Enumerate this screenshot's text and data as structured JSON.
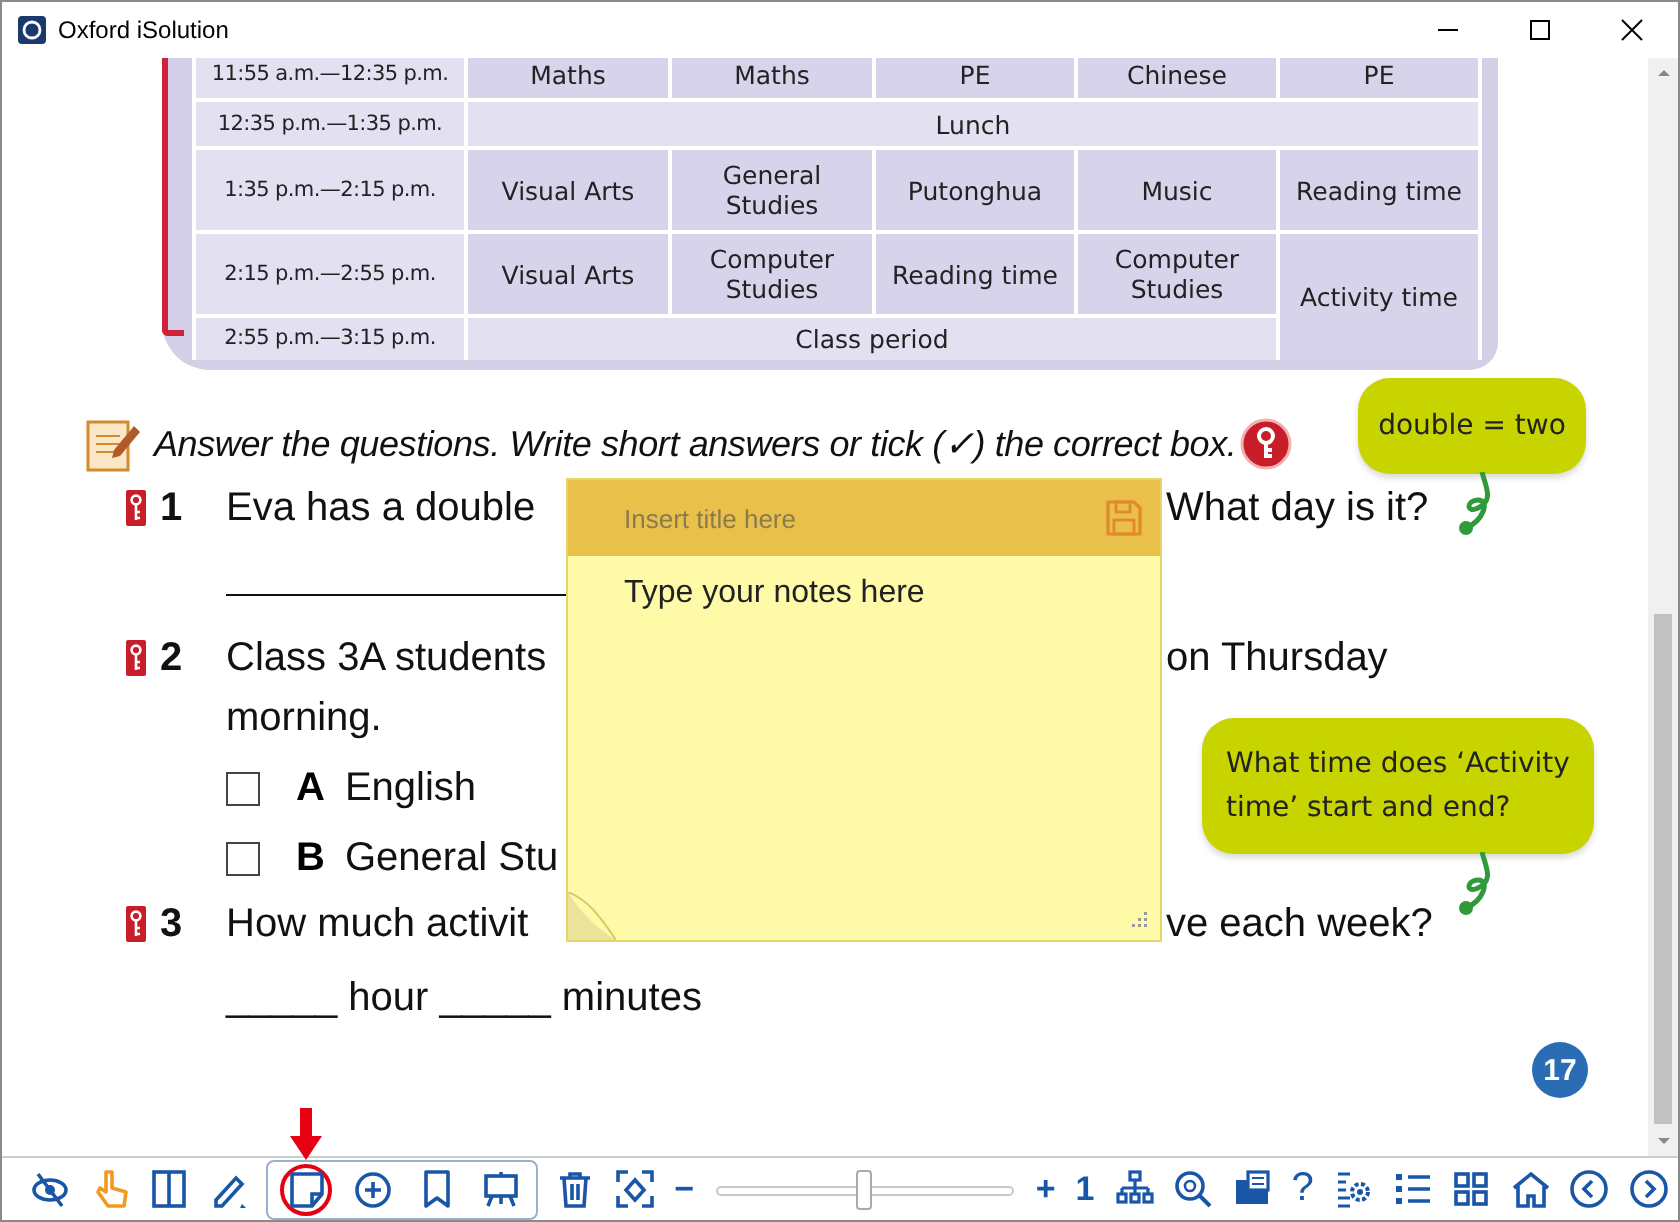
{
  "window": {
    "title": "Oxford iSolution"
  },
  "timetable": {
    "rows": [
      {
        "time": "11:55 a.m.—12:35 p.m.",
        "cells": [
          {
            "text": "Maths"
          },
          {
            "text": "Maths"
          },
          {
            "text": "PE"
          },
          {
            "text": "Chinese"
          },
          {
            "text": "PE"
          }
        ]
      },
      {
        "time": "12:35 p.m.—1:35 p.m.",
        "kind": "break",
        "cells": [
          {
            "text": "Lunch",
            "colspan": 5
          }
        ]
      },
      {
        "time": "1:35 p.m.—2:15 p.m.",
        "cells": [
          {
            "text": "Visual Arts"
          },
          {
            "text": "General Studies"
          },
          {
            "text": "Putonghua"
          },
          {
            "text": "Music"
          },
          {
            "text": "Reading time"
          }
        ]
      },
      {
        "time": "2:15 p.m.—2:55 p.m.",
        "cells": [
          {
            "text": "Visual Arts"
          },
          {
            "text": "Computer Studies"
          },
          {
            "text": "Reading time"
          },
          {
            "text": "Computer Studies"
          },
          {
            "text": "Activity time",
            "rowspan": 2
          }
        ]
      },
      {
        "time": "2:55 p.m.—3:15 p.m.",
        "kind": "break",
        "cells": [
          {
            "text": "Class period",
            "colspan": 4
          }
        ]
      }
    ]
  },
  "instruction": "Answer the questions. Write short answers or tick (✓) the correct box.",
  "questions": [
    {
      "number": "1",
      "lines": [
        {
          "left": "Eva has a double",
          "right": "What day is it?"
        }
      ],
      "answer_line": true
    },
    {
      "number": "2",
      "lines": [
        {
          "left": "Class 3A students",
          "right": "on Thursday"
        },
        {
          "left": "morning."
        }
      ],
      "options": [
        {
          "letter": "A",
          "text": "English",
          "checked": false
        },
        {
          "letter": "B",
          "text": "General Stu",
          "checked": false
        }
      ]
    },
    {
      "number": "3",
      "lines": [
        {
          "left": "How much activit",
          "right": "ve each week?"
        }
      ],
      "answer_text": "_____ hour _____ minutes"
    }
  ],
  "bubbles": [
    {
      "text": "double = two"
    },
    {
      "text": "What time does ‘Activity time’ start and end?"
    }
  ],
  "page_number": "17",
  "note": {
    "title_placeholder": "Insert title here",
    "body_placeholder": "Type your notes here"
  },
  "toolbar": {
    "tools": [
      {
        "selected": false
      },
      {
        "selected": false
      },
      {
        "selected": false
      },
      {
        "selected": false
      },
      {
        "selected": true
      },
      {
        "selected": false
      },
      {
        "selected": false
      },
      {
        "selected": false
      },
      {
        "selected": false
      },
      {
        "selected": false
      }
    ],
    "zoom": {
      "minus": "−",
      "plus": "+",
      "level": 0.5
    },
    "page": "1",
    "help": "?"
  }
}
